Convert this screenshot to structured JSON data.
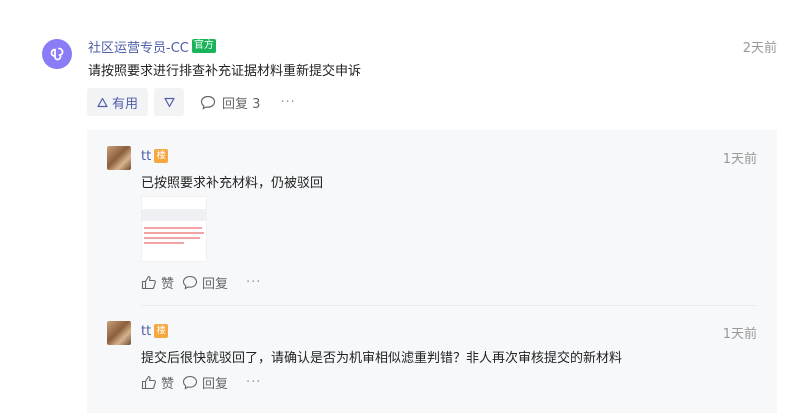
{
  "comment": {
    "author": "社区运营专员-CC",
    "badge": "官方",
    "time": "2天前",
    "text": "请按照要求进行排查补充证据材料重新提交申诉",
    "useful_label": "有用",
    "reply_label": "回复 3",
    "more_label": "···"
  },
  "replies": [
    {
      "author": "tt",
      "badge": "楼",
      "time": "1天前",
      "text": "已按照要求补充材料，仍被驳回",
      "like_label": "赞",
      "reply_label": "回复",
      "more_label": "···"
    },
    {
      "author": "tt",
      "badge": "楼",
      "time": "1天前",
      "text": "提交后很快就驳回了，请确认是否为机审相似滤重判错？非人再次审核提交的新材料",
      "like_label": "赞",
      "reply_label": "回复",
      "more_label": "···"
    }
  ],
  "colors": {
    "link": "#4e5ea8",
    "official_badge": "#19b35a",
    "floor_badge": "#f5a742",
    "avatar_main": "#8a7cf6"
  },
  "icons": [
    "mini-program-icon",
    "thumbs-up-outline-icon",
    "thumbs-down-outline-icon",
    "comment-bubble-icon",
    "like-icon"
  ]
}
